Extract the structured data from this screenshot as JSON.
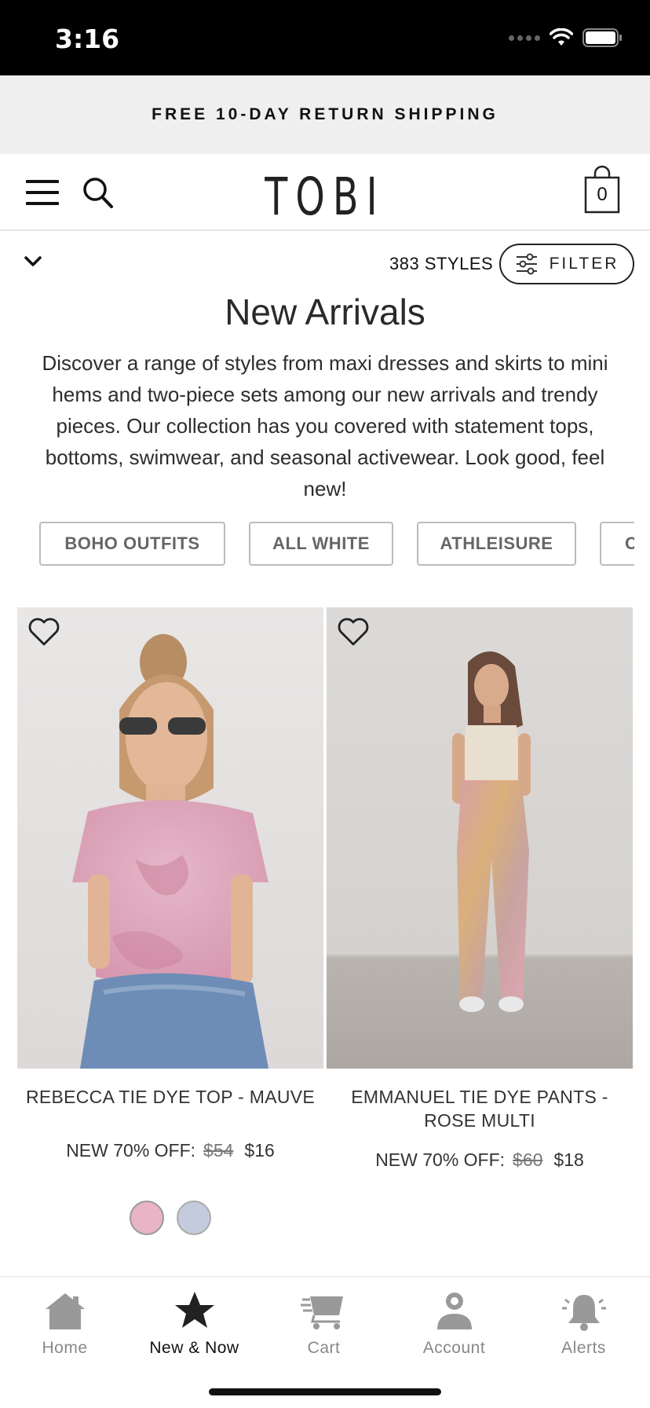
{
  "status": {
    "time": "3:16"
  },
  "promo": {
    "text": "FREE 10-DAY RETURN SHIPPING"
  },
  "header": {
    "logo": "TOBI",
    "cart_count": "0"
  },
  "listing": {
    "styles_count": "383 STYLES",
    "filter_label": "FILTER",
    "title": "New Arrivals",
    "description": "Discover a range of styles from maxi dresses and skirts to mini hems and two-piece sets among our new arrivals and trendy pieces. Our collection has you covered with statement tops, bottoms, swimwear, and seasonal activewear. Look good, feel new!",
    "chips": [
      "BOHO OUTFITS",
      "ALL WHITE",
      "ATHLEISURE",
      "C"
    ]
  },
  "products": [
    {
      "name": "REBECCA TIE DYE TOP - MAUVE",
      "price_label": "NEW 70% OFF:",
      "old_price": "$54",
      "new_price": "$16",
      "swatches": [
        "#e8b4c6",
        "#c3cbdc"
      ]
    },
    {
      "name": "EMMANUEL TIE DYE PANTS - ROSE MULTI",
      "price_label": "NEW 70% OFF:",
      "old_price": "$60",
      "new_price": "$18"
    }
  ],
  "tabbar": {
    "items": [
      {
        "label": "Home",
        "icon": "home-icon"
      },
      {
        "label": "New & Now",
        "icon": "star-icon",
        "active": true
      },
      {
        "label": "Cart",
        "icon": "cart-icon"
      },
      {
        "label": "Account",
        "icon": "account-icon"
      },
      {
        "label": "Alerts",
        "icon": "bell-icon"
      }
    ]
  },
  "colors": {
    "accent": "#111111",
    "muted": "#888888",
    "promo_bg": "#efefef"
  }
}
